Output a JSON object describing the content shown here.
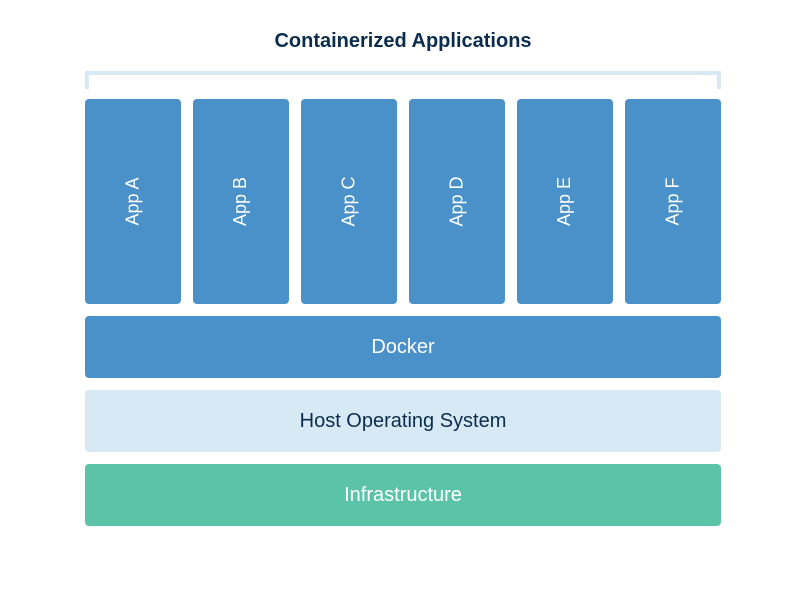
{
  "title": "Containerized Applications",
  "apps": [
    {
      "label": "App A"
    },
    {
      "label": "App B"
    },
    {
      "label": "App C"
    },
    {
      "label": "App D"
    },
    {
      "label": "App E"
    },
    {
      "label": "App F"
    }
  ],
  "layers": {
    "docker": "Docker",
    "host": "Host Operating System",
    "infrastructure": "Infrastructure"
  },
  "colors": {
    "app_blue": "#4a90c9",
    "light_blue": "#d6e9f5",
    "green": "#5bc4a8",
    "title_dark": "#0b2c4d"
  }
}
